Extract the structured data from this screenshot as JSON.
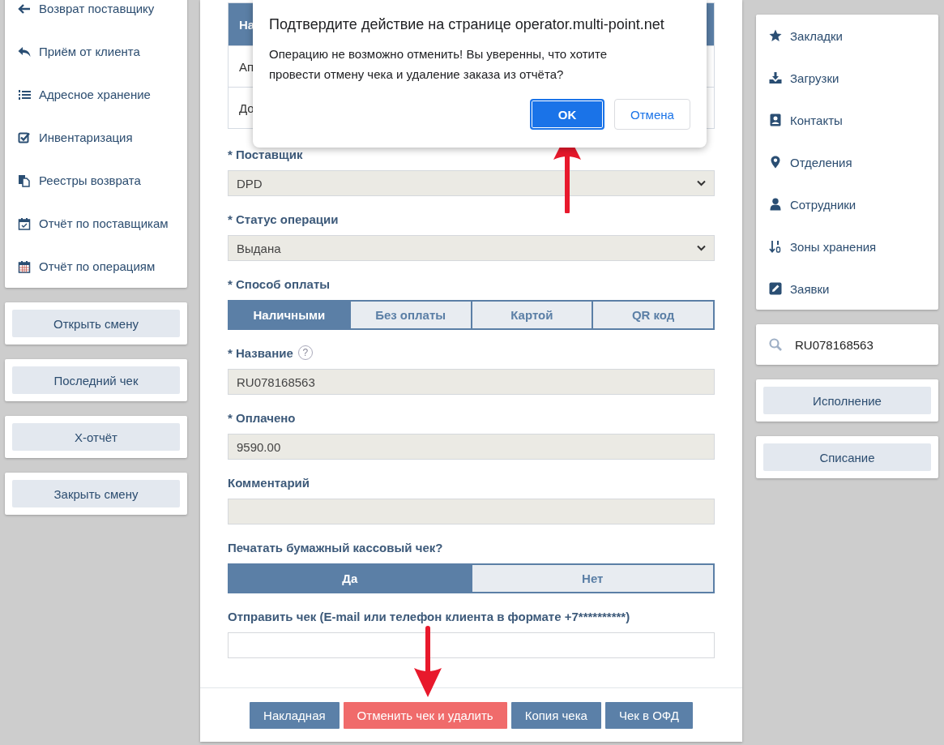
{
  "left_menu": {
    "items": [
      {
        "label": "Возврат поставщику"
      },
      {
        "label": "Приём от клиента"
      },
      {
        "label": "Адресное хранение"
      },
      {
        "label": "Инвентаризация"
      },
      {
        "label": "Реестры возврата"
      },
      {
        "label": "Отчёт по поставщикам"
      },
      {
        "label": "Отчёт по операциям"
      }
    ]
  },
  "left_buttons": [
    "Открыть смену",
    "Последний чек",
    "X-отчёт",
    "Закрыть смену"
  ],
  "main": {
    "table": {
      "header": "На",
      "rows": [
        "Ап",
        "До"
      ]
    },
    "fields": [
      {
        "kind": "select",
        "label": "* Поставщик",
        "value": "DPD",
        "disabled": true
      },
      {
        "kind": "select",
        "label": "* Статус операции",
        "value": "Выдана",
        "disabled": true
      },
      {
        "kind": "segmented",
        "label": "* Способ оплаты",
        "options": [
          {
            "label": "Наличными",
            "selected": true
          },
          {
            "label": "Без оплаты",
            "selected": false
          },
          {
            "label": "Картой",
            "selected": false
          },
          {
            "label": "QR код",
            "selected": false
          }
        ]
      },
      {
        "kind": "input",
        "label": "* Название",
        "help": "?",
        "value": "RU078168563",
        "disabled": true
      },
      {
        "kind": "input",
        "label": "* Оплачено",
        "value": "9590.00",
        "disabled": true
      },
      {
        "kind": "input",
        "label": "Комментарий",
        "disabled": true
      },
      {
        "kind": "segmented",
        "label": "Печатать бумажный кассовый чек?",
        "options": [
          {
            "label": "Да",
            "selected": true
          },
          {
            "label": "Нет",
            "selected": false
          }
        ]
      },
      {
        "kind": "input",
        "label": "Отправить чек (E-mail или телефон клиента в формате +7**********)",
        "disabled": false
      }
    ],
    "footer_buttons": [
      {
        "label": "Накладная",
        "kind": "primary"
      },
      {
        "label": "Отменить чек и удалить",
        "kind": "danger"
      },
      {
        "label": "Копия чека",
        "kind": "primary"
      },
      {
        "label": "Чек в ОФД",
        "kind": "primary"
      }
    ]
  },
  "dialog": {
    "title": "Подтвердите действие на странице operator.multi-point.net",
    "message": "Операцию не возможно отменить! Вы уверенны, что хотите провести отмену чека и удаление заказа из отчёта?",
    "buttons": [
      {
        "label": "OK",
        "kind": "primary"
      },
      {
        "label": "Отмена",
        "kind": "secondary"
      }
    ]
  },
  "right_menu": {
    "items": [
      {
        "label": "Закладки"
      },
      {
        "label": "Загрузки"
      },
      {
        "label": "Контакты"
      },
      {
        "label": "Отделения"
      },
      {
        "label": "Сотрудники"
      },
      {
        "label": "Зоны хранения"
      },
      {
        "label": "Заявки"
      }
    ]
  },
  "search": {
    "value": "RU078168563"
  },
  "right_buttons": [
    "Исполнение",
    "Списание"
  ]
}
